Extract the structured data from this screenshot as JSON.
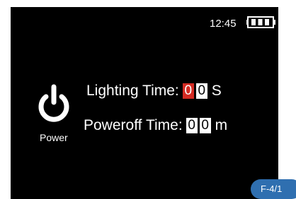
{
  "status_bar": {
    "time": "12:45",
    "battery_icon": "battery-full-icon",
    "battery_level": 1.0
  },
  "power": {
    "icon": "power-icon",
    "label": "Power"
  },
  "settings": {
    "lighting_time": {
      "label": "Lighting Time:",
      "digits": [
        "0",
        "0"
      ],
      "unit": "S",
      "selected_digit_index": 0
    },
    "poweroff_time": {
      "label": "Poweroff Time:",
      "digits": [
        "0",
        "0"
      ],
      "unit": "m"
    }
  },
  "page_indicator": "F-4/1",
  "colors": {
    "screen_background": "#000000",
    "selected_digit": "#d42b23",
    "page_badge": "#2f6fb0"
  }
}
